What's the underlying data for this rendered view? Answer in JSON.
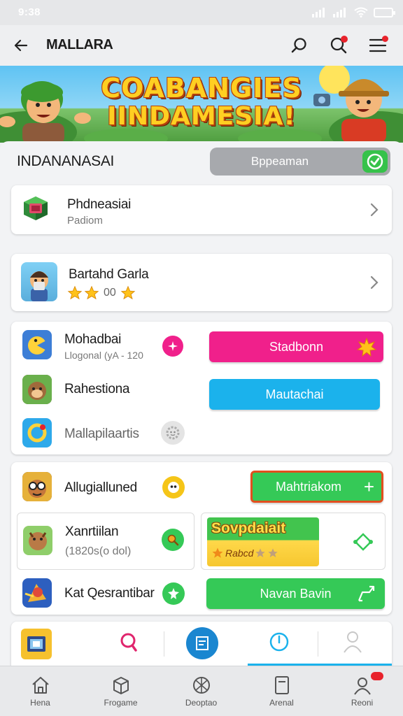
{
  "status": {
    "time": "9:38"
  },
  "appbar": {
    "title": "MALLARA",
    "back_icon": "arrow-left-icon",
    "search_icon": "search-icon",
    "alert_icon": "notification-search-icon",
    "menu_icon": "hamburger-menu-icon"
  },
  "banner": {
    "title_line1": "COABANGIES",
    "title_line2": "IINDAMESIA!"
  },
  "section": {
    "title": "INDANANASAI",
    "toggle_label": "Bppeaman",
    "toggle_state": "on"
  },
  "card1": {
    "title": "Phdneasiai",
    "subtitle": "Padiom"
  },
  "card2": {
    "title": "Bartahd Garla",
    "rating_text": "00"
  },
  "group1": {
    "row1": {
      "title": "Mohadbai",
      "subtitle": "Llogonal (yA - 120",
      "button": "Stadbonn"
    },
    "row2": {
      "title": "Rahestiona",
      "button": "Mautachai"
    },
    "row3": {
      "title": "Mallapilaartis"
    }
  },
  "group2": {
    "row1": {
      "title": "Allugialluned",
      "button": "Mahtriakom",
      "button_symbol": "+"
    },
    "row2": {
      "title": "Xanrtiilan",
      "subtitle": "(1820s(o dol)",
      "promo_title": "Sovpdaiait",
      "promo_sub": "Rabcd"
    },
    "row3": {
      "title": "Kat Qesrantibar",
      "button": "Navan Bavin"
    }
  },
  "bottom_nav": [
    {
      "label": "Hena",
      "icon": "home-icon"
    },
    {
      "label": "Frogame",
      "icon": "box-icon"
    },
    {
      "label": "Deoptao",
      "icon": "ball-icon"
    },
    {
      "label": "Arenal",
      "icon": "card-icon"
    },
    {
      "label": "Reoni",
      "icon": "profile-icon"
    }
  ],
  "colors": {
    "pink": "#f0208b",
    "blue": "#1bb2ec",
    "green": "#35c957",
    "orange_border": "#e24f1e",
    "toggle": "#a7a9ad",
    "check": "#36c24a"
  }
}
